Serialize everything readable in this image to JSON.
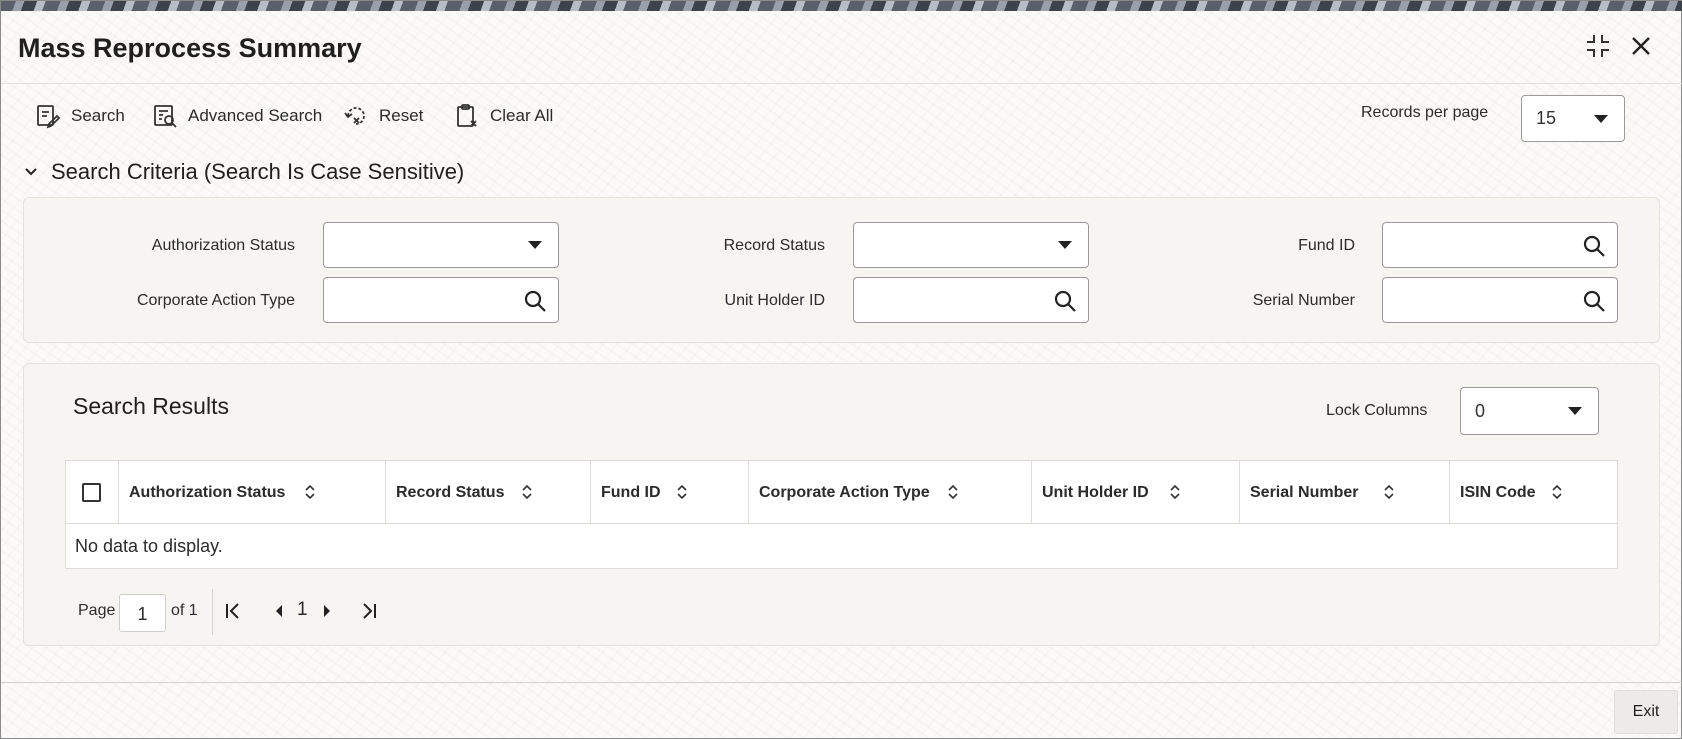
{
  "window": {
    "title": "Mass Reprocess Summary"
  },
  "toolbar": {
    "search_label": "Search",
    "advanced_search_label": "Advanced Search",
    "reset_label": "Reset",
    "clear_all_label": "Clear All",
    "records_per_page_label": "Records per page",
    "records_per_page_value": "15"
  },
  "search_criteria": {
    "heading": "Search Criteria (Search Is Case Sensitive)",
    "fields": [
      {
        "label": "Authorization Status",
        "type": "select",
        "value": ""
      },
      {
        "label": "Record Status",
        "type": "select",
        "value": ""
      },
      {
        "label": "Fund ID",
        "type": "lookup",
        "value": ""
      },
      {
        "label": "Corporate Action Type",
        "type": "lookup",
        "value": ""
      },
      {
        "label": "Unit Holder ID",
        "type": "lookup",
        "value": ""
      },
      {
        "label": "Serial Number",
        "type": "lookup",
        "value": ""
      }
    ]
  },
  "results": {
    "heading": "Search Results",
    "lock_columns_label": "Lock Columns",
    "lock_columns_value": "0",
    "columns": [
      "Authorization Status",
      "Record Status",
      "Fund ID",
      "Corporate Action Type",
      "Unit Holder ID",
      "Serial Number",
      "ISIN Code"
    ],
    "empty_message": "No data to display."
  },
  "pagination": {
    "page_label": "Page",
    "current_page_input": "1",
    "of_label": "of 1",
    "current_page": "1"
  },
  "footer": {
    "exit_label": "Exit"
  }
}
